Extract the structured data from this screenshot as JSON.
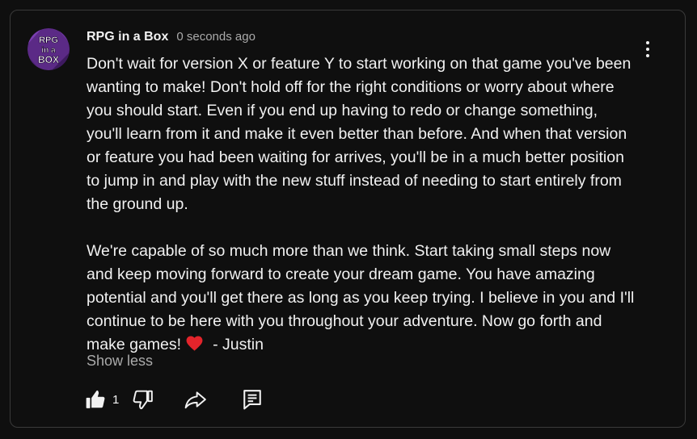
{
  "comment": {
    "author": "RPG in a Box",
    "timestamp": "0 seconds ago",
    "avatar_text": [
      "RPG",
      "in a",
      "BOX"
    ],
    "paragraphs": [
      "Don't wait for version X or feature Y to start working on that game you've been wanting to make! Don't hold off for the right conditions or worry about where you should start. Even if you end up having to redo or change something, you'll learn from it and make it even better than before. And when that version or feature you had been waiting for arrives, you'll be in a much better position to jump in and play with the new stuff instead of needing to start entirely from the ground up.",
      "We're capable of so much more than we think. Start taking small steps now and keep moving forward to create your dream game. You have amazing potential and you'll get there as long as you keep trying. I believe in you and I'll continue to be here with you throughout your adventure. Now go forth and make games!"
    ],
    "signature": "- Justin",
    "show_less_label": "Show less",
    "like_count": "1"
  },
  "icons": {
    "avatar": "rpg-in-a-box-logo",
    "menu": "more-vertical-icon",
    "heart": "heart-icon",
    "like": "thumbs-up-filled-icon",
    "dislike": "thumbs-down-outline-icon",
    "share": "share-arrow-icon",
    "reply": "reply-comment-icon"
  },
  "colors": {
    "background": "#0f0f0f",
    "border": "#3a3a3a",
    "text": "#f1f1f1",
    "secondary_text": "#aaaaaa",
    "heart": "#e3242b",
    "avatar_purple": "#5b2a86"
  }
}
